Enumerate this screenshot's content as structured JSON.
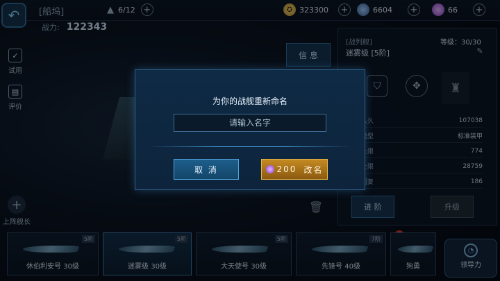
{
  "header": {
    "title": "[船坞]",
    "fleet_count": "6/12",
    "power_label": "战力:",
    "power_value": "122343"
  },
  "resources": {
    "gold": "323300",
    "crystal": "6604",
    "gem": "66"
  },
  "side_menu": {
    "trial_label": "试用",
    "review_label": "评价",
    "add_captain_label": "上阵舰长"
  },
  "info_tab": "信 息",
  "ship_panel": {
    "class_label": "[战列舰]",
    "ship_name": "迷雾级 [5阶]",
    "level_label": "等级：30/30",
    "stats": [
      {
        "name": "久久",
        "value": "107038"
      },
      {
        "name": "类型",
        "value": "标准装甲"
      },
      {
        "name": "上限",
        "value": "774"
      },
      {
        "name": "上限",
        "value": "28759"
      },
      {
        "name": "回复",
        "value": "186"
      }
    ],
    "advance_button": "进 阶",
    "upgrade_button": "升级"
  },
  "ship_list": [
    {
      "name": "休伯利安号 30级",
      "tier": "5阶"
    },
    {
      "name": "迷雾级 30级",
      "tier": "5阶"
    },
    {
      "name": "大天使号 30级",
      "tier": "5阶"
    },
    {
      "name": "先锋号 40级",
      "tier": "7阶"
    },
    {
      "name": "狗勇",
      "tier": ""
    }
  ],
  "leadership_label": "领导力",
  "rename_dialog": {
    "title": "为你的战舰重新命名",
    "input_placeholder": "请输入名字",
    "cancel_label": "取 消",
    "rename_cost": "200",
    "rename_label": "改名"
  },
  "colors": {
    "accent": "#4aa6e3",
    "gold_button": "#c48a22",
    "gem": "#a45be0"
  }
}
